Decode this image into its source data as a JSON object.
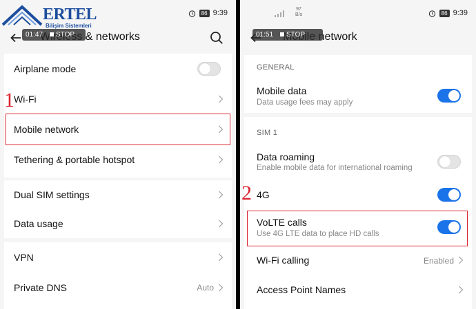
{
  "logo": {
    "name": "ERTEL",
    "subtitle": "Bilişim Sistemleri"
  },
  "left": {
    "status": {
      "battery": "86",
      "time": "9:39"
    },
    "timer": {
      "elapsed": "01:47",
      "stop_label": "STOP"
    },
    "title": "Wireless & networks",
    "step": "1",
    "items": [
      {
        "label": "Airplane mode",
        "control": "toggle",
        "on": false
      },
      {
        "label": "Wi-Fi",
        "control": "chevron"
      },
      {
        "label": "Mobile network",
        "control": "chevron"
      },
      {
        "label": "Tethering & portable hotspot",
        "control": "chevron"
      },
      {
        "label": "Dual SIM settings",
        "control": "chevron"
      },
      {
        "label": "Data usage",
        "control": "chevron"
      },
      {
        "label": "VPN",
        "control": "chevron"
      },
      {
        "label": "Private DNS",
        "control": "chevron",
        "value": "Auto"
      }
    ]
  },
  "right": {
    "status": {
      "net_speed_value": "97",
      "net_speed_unit": "B/s",
      "battery": "86",
      "time": "9:39"
    },
    "timer": {
      "elapsed": "01:51",
      "stop_label": "STOP"
    },
    "title": "Mobile network",
    "step": "2",
    "sections": {
      "general": "GENERAL",
      "sim1": "SIM 1"
    },
    "items": [
      {
        "label": "Mobile data",
        "sub": "Data usage fees may apply",
        "control": "toggle",
        "on": true
      },
      {
        "label": "Data roaming",
        "sub": "Enable mobile data for international roaming",
        "control": "toggle",
        "on": false
      },
      {
        "label": "4G",
        "control": "toggle",
        "on": true
      },
      {
        "label": "VoLTE calls",
        "sub": "Use 4G LTE data to place HD calls",
        "control": "toggle",
        "on": true
      },
      {
        "label": "Wi-Fi calling",
        "control": "chevron",
        "value": "Enabled"
      },
      {
        "label": "Access Point Names",
        "control": "chevron"
      }
    ]
  },
  "colors": {
    "accent": "#1a73e8",
    "highlight": "#d9232e",
    "brand": "#1d4e9e"
  }
}
